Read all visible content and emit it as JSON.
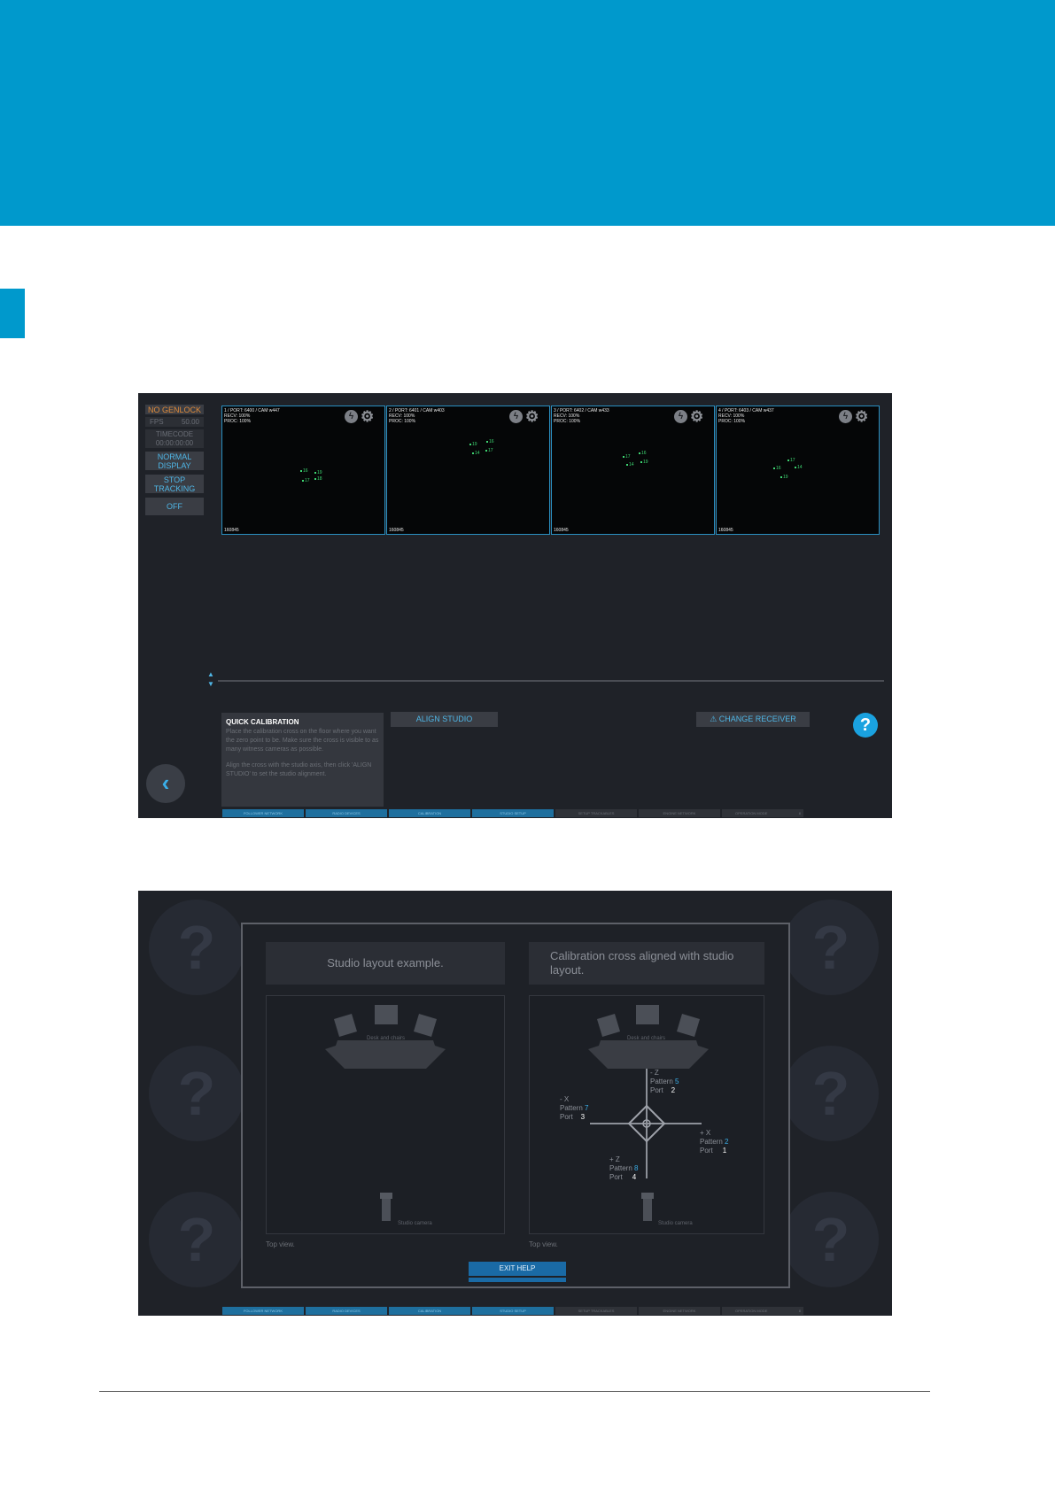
{
  "left_panel": {
    "genlock": "NO GENLOCK",
    "fps_label": "FPS",
    "fps_value": "50.00",
    "timecode_label": "TIMECODE",
    "timecode_value": "00:00:00:00",
    "display_line1": "NORMAL",
    "display_line2": "DISPLAY",
    "tracking_line1": "STOP",
    "tracking_line2": "TRACKING",
    "off": "OFF"
  },
  "cameras": [
    {
      "title": "1 / PORT: 6400 / CAM w447",
      "recv": "RECV: 100%",
      "proc": "PROC: 100%",
      "footer": "160845",
      "markers": [
        "16",
        "19",
        "17",
        "18"
      ]
    },
    {
      "title": "2 / PORT: 6401 / CAM w403",
      "recv": "RECV: 100%",
      "proc": "PROC: 100%",
      "footer": "160845",
      "markers": [
        "19",
        "16",
        "14",
        "17"
      ]
    },
    {
      "title": "3 / PORT: 6402 / CAM w433",
      "recv": "RECV: 100%",
      "proc": "PROC: 100%",
      "footer": "160845",
      "markers": [
        "17",
        "16",
        "14",
        "19"
      ]
    },
    {
      "title": "4 / PORT: 6403 / CAM w437",
      "recv": "RECV: 100%",
      "proc": "PROC: 100%",
      "footer": "160845",
      "markers": [
        "17",
        "16",
        "14",
        "19"
      ]
    }
  ],
  "quick_calibration": {
    "title": "QUICK CALIBRATION",
    "text1": "Place the calibration cross on the floor where you want the zero point to be. Make sure the cross is visible to as many witness cameras as possible.",
    "text2": "Align the cross with the studio axis, then click 'ALIGN STUDIO' to set the studio alignment."
  },
  "buttons": {
    "align_studio": "ALIGN STUDIO",
    "change_receiver": "CHANGE RECEIVER",
    "help": "?",
    "back": "‹",
    "exit_help": "EXIT HELP"
  },
  "icons": {
    "warning": "⚠",
    "lightning": "ϟ",
    "gear": "⚙",
    "up": "▲",
    "down": "▼"
  },
  "nav": [
    "FOLLOWER NETWORK",
    "RADIO DEVICES",
    "CALIBRATION",
    "STUDIO SETUP",
    "SETUP TRACKABLES",
    "ENGINE NETWORK",
    "OPERATION MODE"
  ],
  "nav_last_suffix": "8",
  "help_overlay": {
    "left_title": "Studio layout example.",
    "right_title": "Calibration cross aligned with studio layout.",
    "desk_label": "Desk and chairs",
    "camera_label": "Studio camera",
    "top_view": "Top view.",
    "bg_mark": "?",
    "axes": {
      "neg_z": "- Z",
      "neg_x": "- X",
      "pos_x": "+ X",
      "pos_z": "+ Z",
      "pattern": "Pattern",
      "port": "Port",
      "neg_z_pattern": "5",
      "neg_z_port": "2",
      "neg_x_pattern": "7",
      "neg_x_port": "3",
      "pos_x_pattern": "2",
      "pos_x_port": "1",
      "pos_z_pattern": "8",
      "pos_z_port": "4"
    }
  },
  "colors": {
    "brand": "#0099cc",
    "accent": "#4fb6e6",
    "warning": "#e08b3a",
    "marker": "#3ed672"
  }
}
